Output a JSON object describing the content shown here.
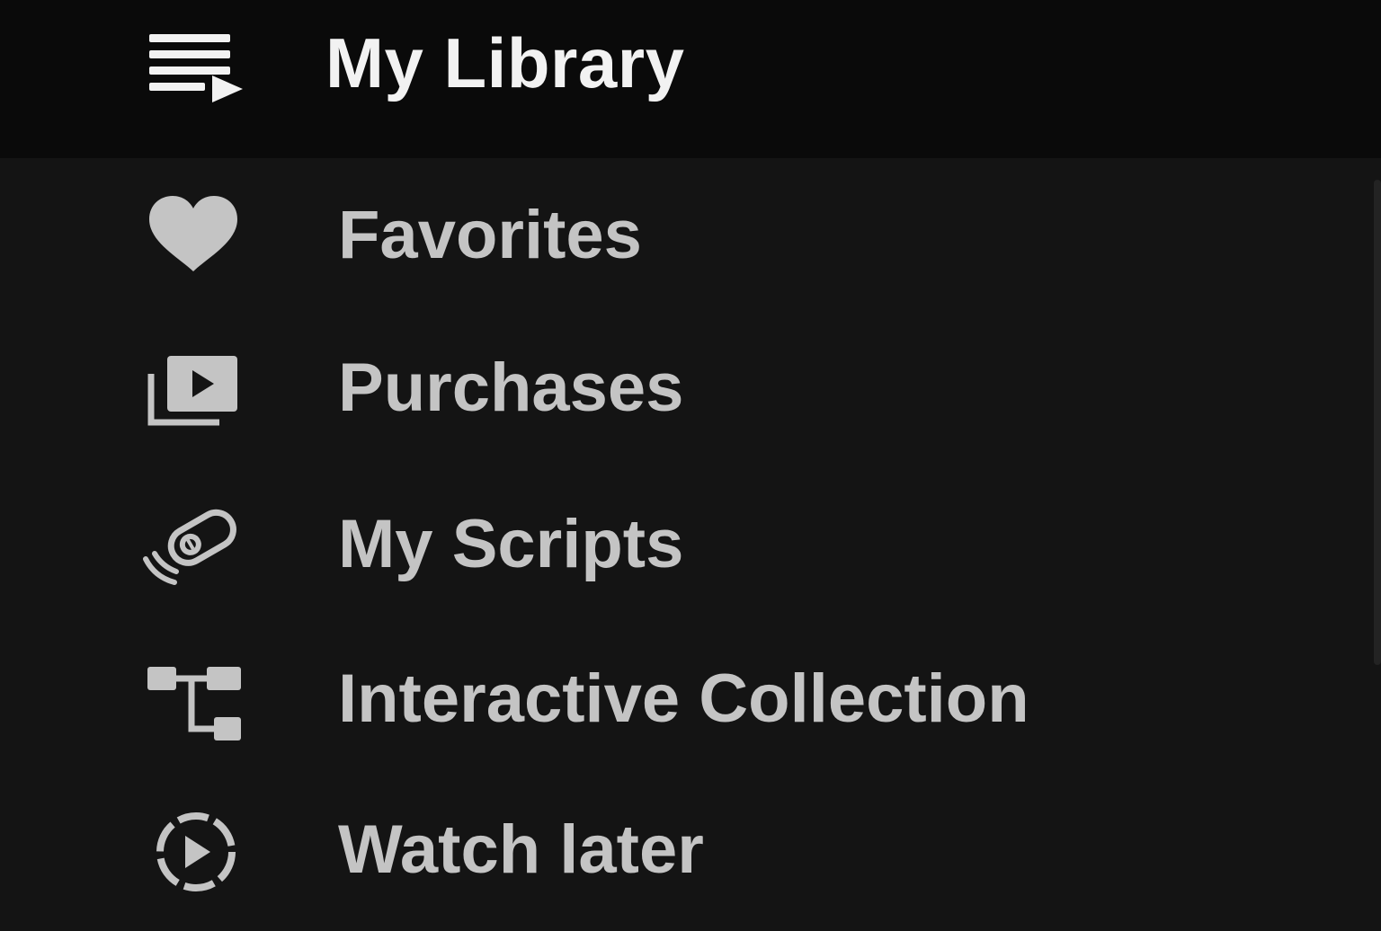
{
  "library": {
    "title": "My Library",
    "icon": "playlist-play-icon"
  },
  "menu": {
    "items": [
      {
        "label": "Favorites",
        "icon": "heart-icon"
      },
      {
        "label": "Purchases",
        "icon": "video-library-icon"
      },
      {
        "label": "My Scripts",
        "icon": "vibrating-device-icon"
      },
      {
        "label": "Interactive Collection",
        "icon": "hierarchy-icon"
      },
      {
        "label": "Watch later",
        "icon": "watch-later-icon"
      }
    ]
  },
  "colors": {
    "header_bg": "#0a0a0a",
    "menu_bg": "#141414",
    "title_text": "#f2f2f2",
    "item_text": "#c4c4c4",
    "icon_color": "#c4c4c4"
  }
}
